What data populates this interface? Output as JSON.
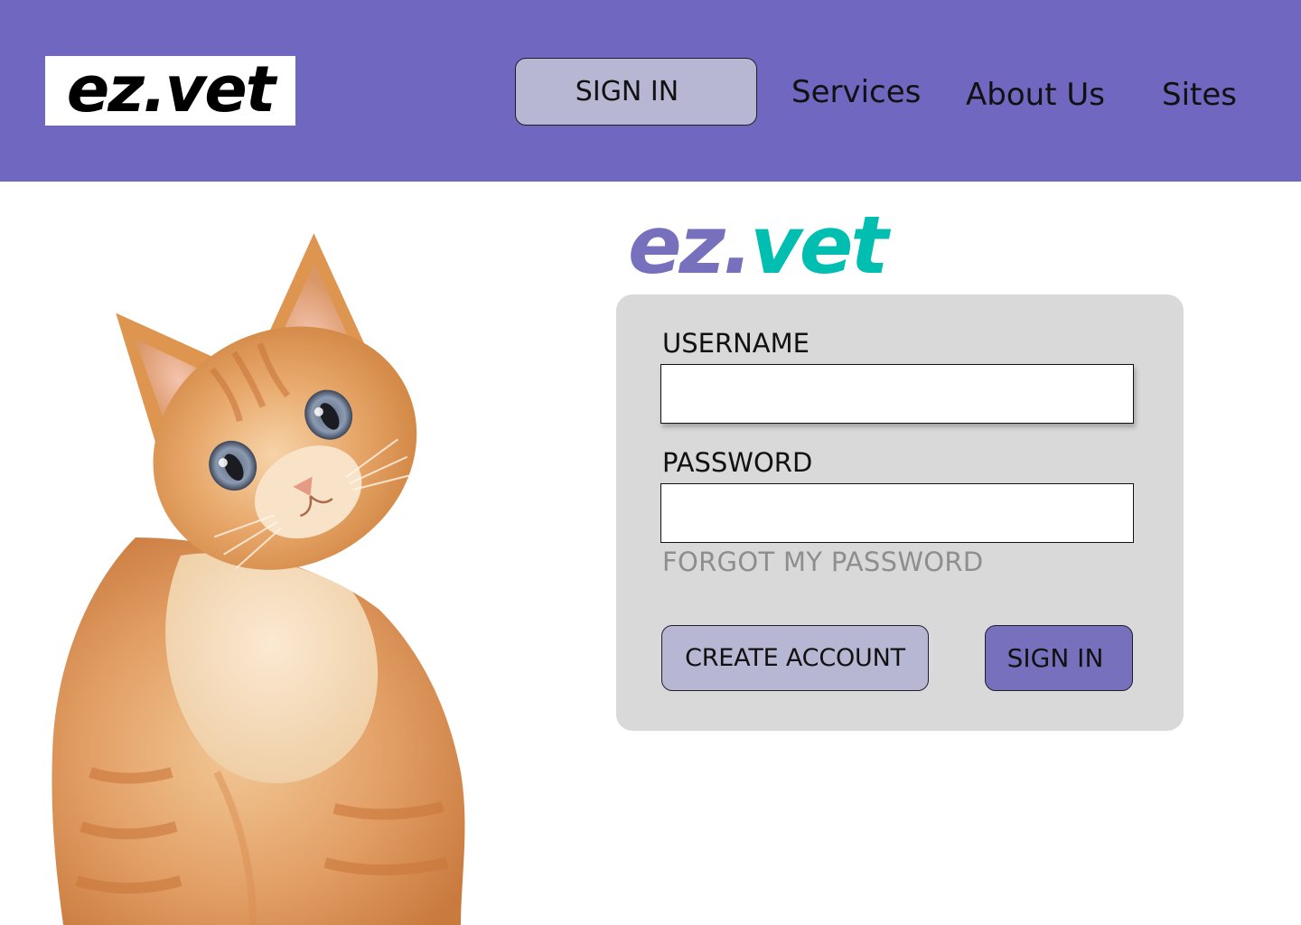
{
  "header": {
    "logo_text": "ez.vet",
    "signin_label": "SIGN IN",
    "nav": [
      {
        "label": "Services"
      },
      {
        "label": "About Us"
      },
      {
        "label": "Sites"
      }
    ]
  },
  "hero": {
    "image": "kitten-photo"
  },
  "brand": {
    "logo_part1": "ez.",
    "logo_part2": "vet",
    "colors": {
      "ez": "#7670bd",
      "vet": "#00bfb0"
    }
  },
  "login": {
    "username_label": "USERNAME",
    "username_value": "",
    "password_label": "PASSWORD",
    "password_value": "",
    "forgot_label": "FORGOT MY PASSWORD",
    "create_account_label": "CREATE ACCOUNT",
    "signin_label": "SIGN IN"
  },
  "colors": {
    "header_bg": "#7067c0",
    "button_light": "#b7b7d3",
    "button_primary": "#7670bd",
    "card_bg": "#d9d9d9"
  }
}
